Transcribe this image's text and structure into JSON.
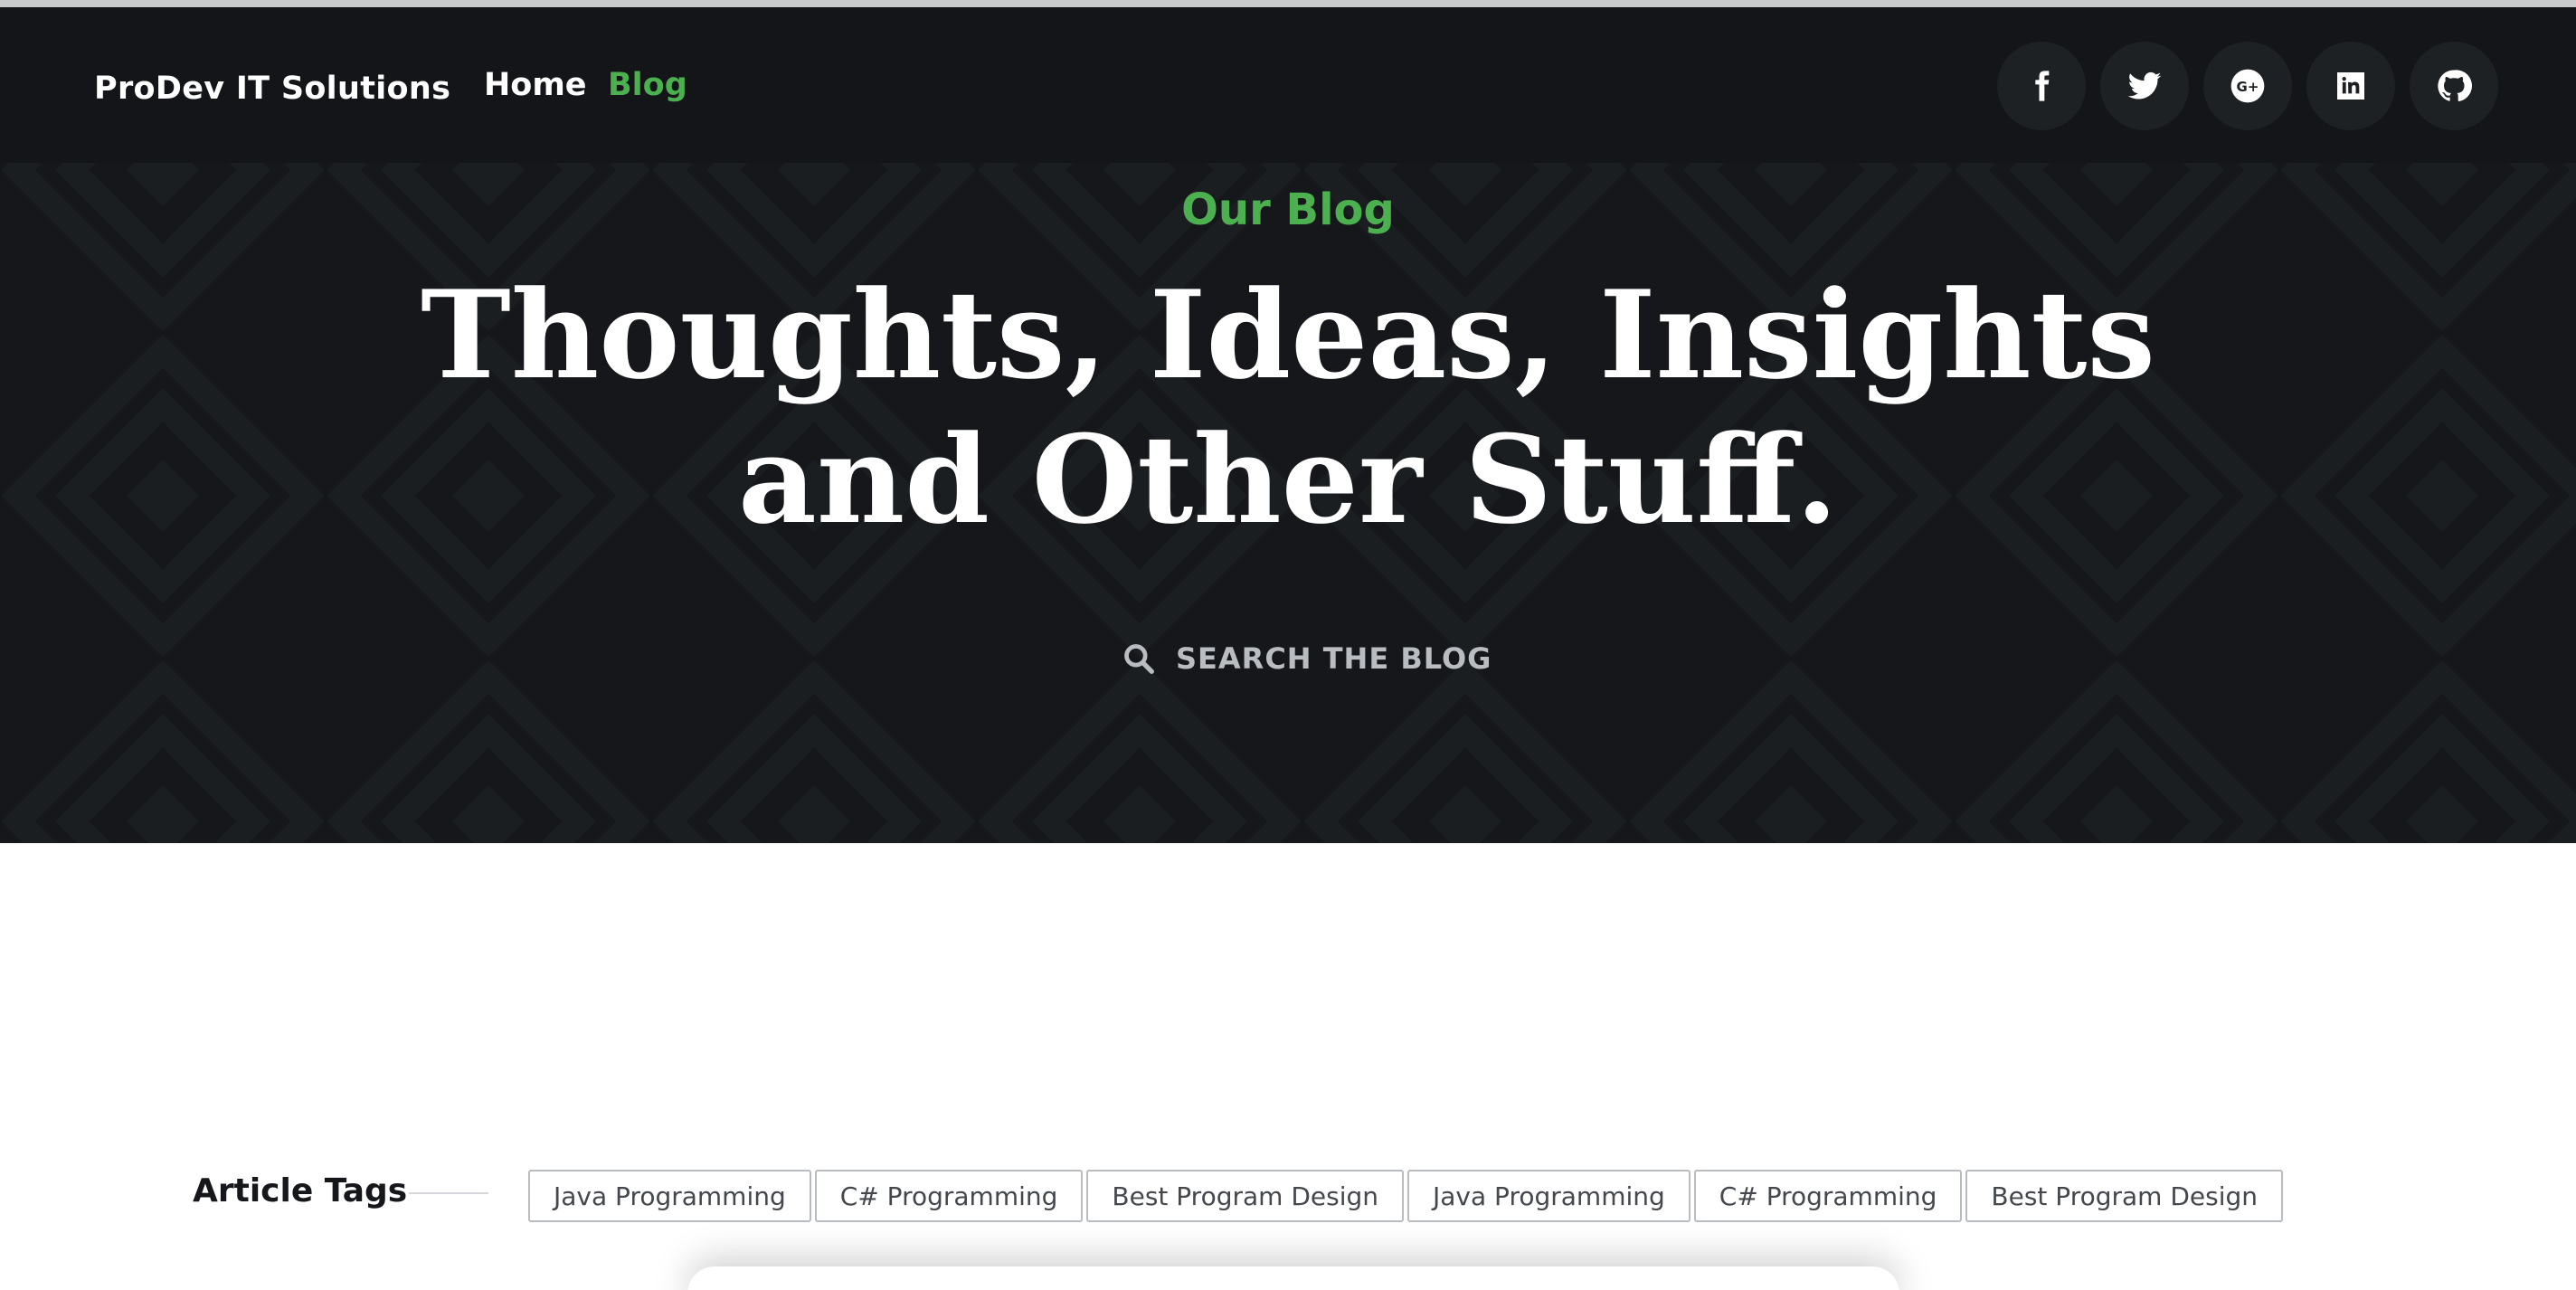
{
  "brand": {
    "name": "ProDev IT Solutions"
  },
  "nav": {
    "items": [
      {
        "label": "Home",
        "active": false
      },
      {
        "label": "Blog",
        "active": true
      }
    ]
  },
  "social": {
    "icons": [
      "facebook-icon",
      "twitter-icon",
      "google-plus-icon",
      "linkedin-icon",
      "github-icon"
    ]
  },
  "hero": {
    "eyebrow": "Our Blog",
    "headline_line1": "Thoughts, Ideas, Insights",
    "headline_line2": "and Other Stuff.",
    "search_label": "SEARCH THE BLOG"
  },
  "tags": {
    "title": "Article Tags",
    "items": [
      "Java Programming",
      "C# Programming",
      "Best Program Design",
      "Java Programming",
      "C# Programming",
      "Best Program Design"
    ]
  },
  "colors": {
    "hero_bg": "#15171a",
    "nav_bg": "#131518",
    "accent": "#4caf50",
    "text_light": "#ffffff",
    "muted": "#b9bcc0"
  }
}
